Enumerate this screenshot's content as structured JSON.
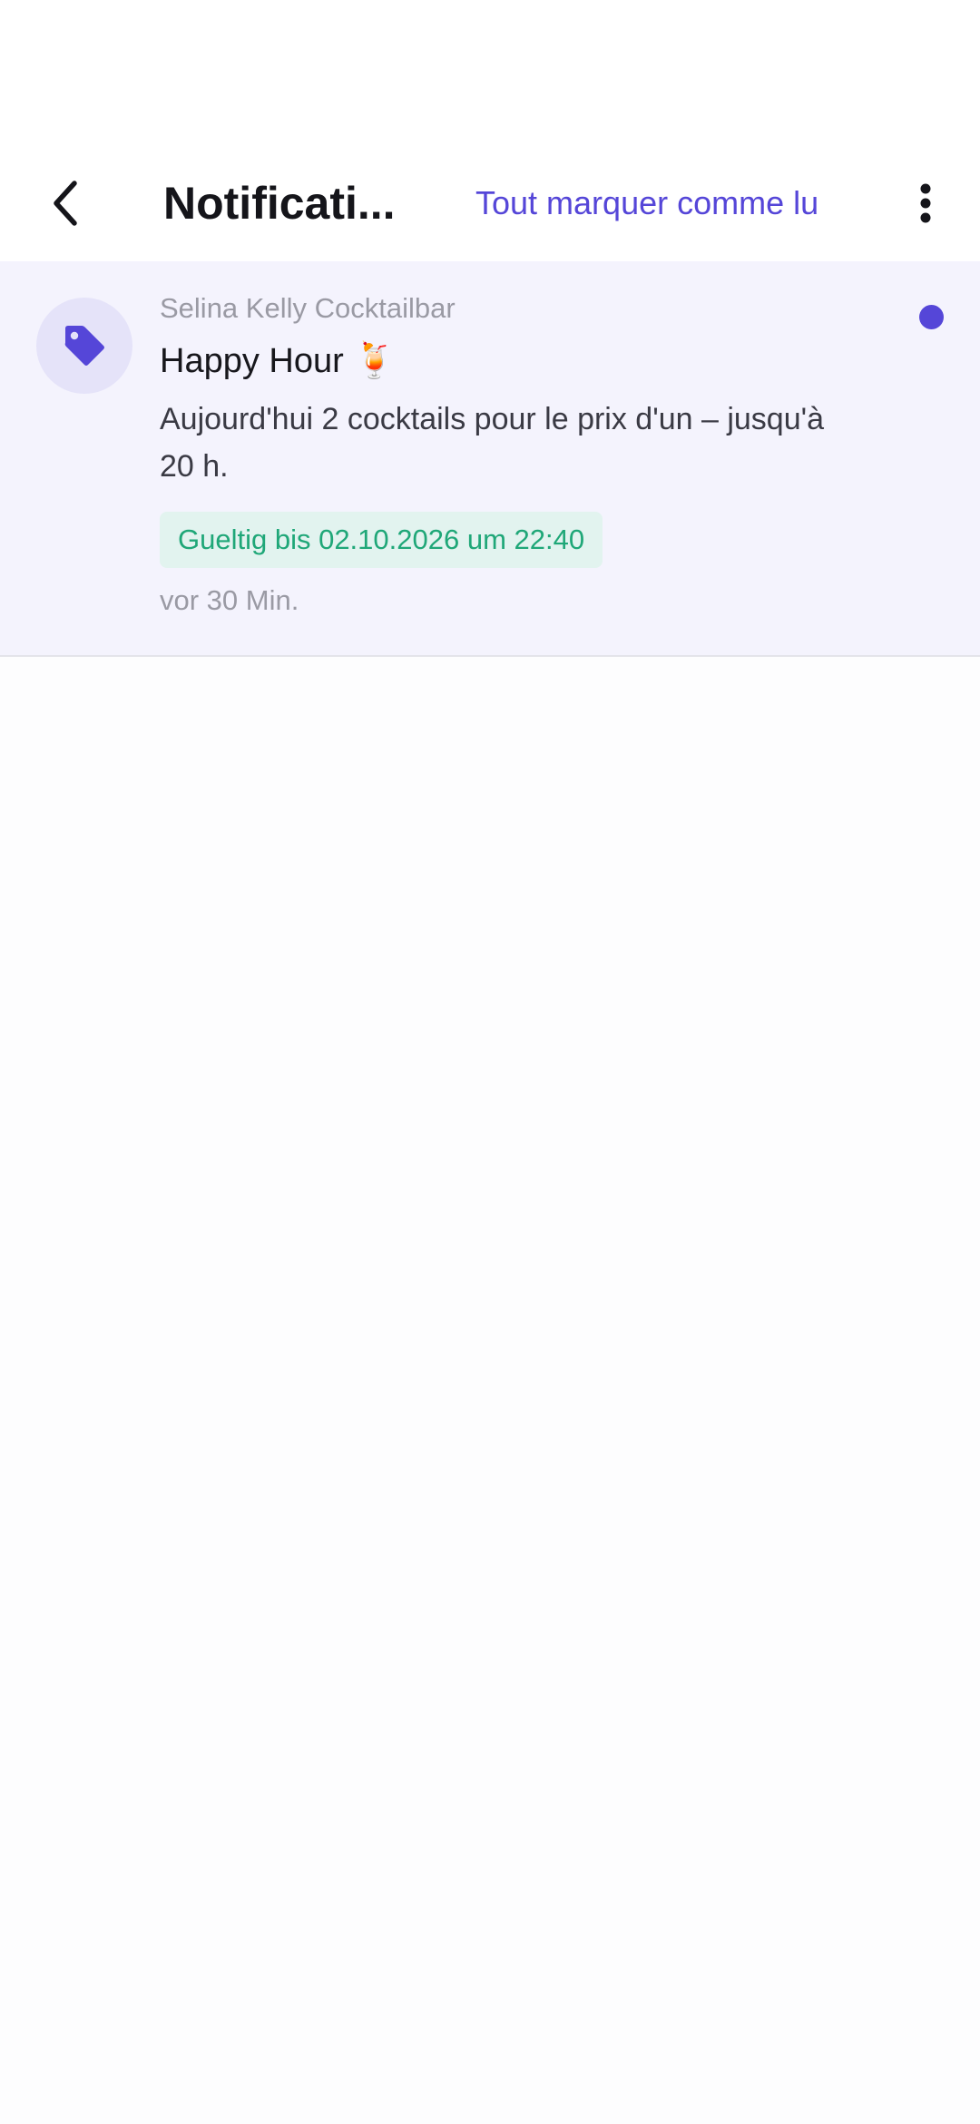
{
  "header": {
    "title": "Notificati...",
    "mark_all_label": "Tout marquer comme lu",
    "back_icon": "chevron-left-icon",
    "more_icon": "more-vertical-icon"
  },
  "notifications": [
    {
      "sender": "Selina Kelly Cocktailbar",
      "title": "Happy Hour 🍹",
      "text": "Aujourd'hui 2 cocktails pour le prix d'un – jusqu'à 20 h.",
      "valid_until": "Gueltig bis 02.10.2026 um 22:40",
      "time_ago": "vor 30 Min.",
      "icon": "tag-icon",
      "unread": true
    }
  ],
  "colors": {
    "accent": "#5546d8",
    "unread_bg": "#f4f3fd",
    "valid_green": "#1fa778",
    "valid_bg": "#e2f3ef"
  }
}
